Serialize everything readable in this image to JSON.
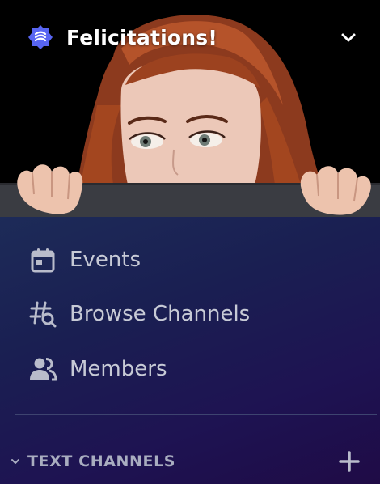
{
  "server": {
    "name": "Felicitations!",
    "badge_icon": "boost-badge-icon",
    "menu_icon": "chevron-down-icon"
  },
  "nav": [
    {
      "label": "Events",
      "icon": "calendar-icon"
    },
    {
      "label": "Browse Channels",
      "icon": "browse-channels-icon"
    },
    {
      "label": "Members",
      "icon": "members-icon"
    }
  ],
  "categories": [
    {
      "label": "TEXT CHANNELS",
      "collapse_icon": "chevron-down-icon",
      "add_icon": "plus-icon"
    }
  ],
  "colors": {
    "badge": "#5865f2",
    "text_muted": "#c7cad6",
    "category_text": "#a9adc0"
  }
}
